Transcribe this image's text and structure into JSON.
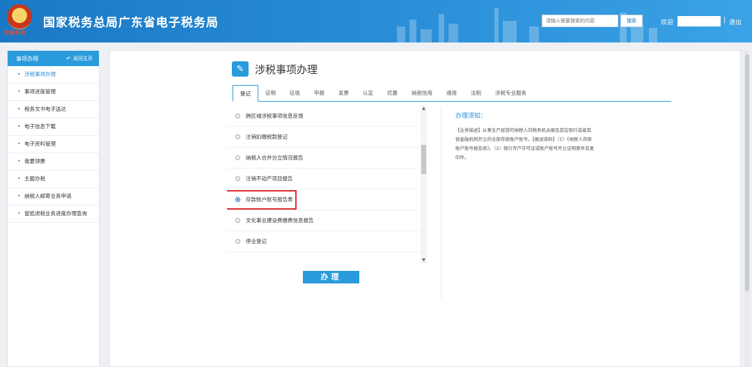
{
  "header": {
    "site_title": "国家税务总局广东省电子税务局",
    "emblem_text": "中国税务",
    "search_placeholder": "请输入需要搜索的内容",
    "search_button": "搜索",
    "welcome": "欢迎",
    "separator": "|",
    "logout": "退出"
  },
  "sidebar": {
    "title": "事项办理",
    "back_label": "返回主页",
    "items": [
      {
        "label": "涉税事项办理",
        "active": true
      },
      {
        "label": "事项进度管理"
      },
      {
        "label": "税务文书电子送达"
      },
      {
        "label": "电子信息下载"
      },
      {
        "label": "电子资料管理"
      },
      {
        "label": "我要领票"
      },
      {
        "label": "主题办税"
      },
      {
        "label": "纳税人邮寄业务申请"
      },
      {
        "label": "留抵退税业务进度办理查询"
      }
    ]
  },
  "main": {
    "title": "涉税事项办理",
    "tabs": [
      "登记",
      "证明",
      "征收",
      "申报",
      "发票",
      "认定",
      "优惠",
      "纳税信用",
      "通用",
      "法制",
      "涉税专业服务"
    ],
    "active_tab": 0,
    "list": [
      "跨区域涉税事项信息反馈",
      "注销扣缴税款登记",
      "纳税人合并分立情况报告",
      "注销不动产项目报告",
      "存款账户账号报告表",
      "文化事业建设费缴费信息报告",
      "停业登记"
    ],
    "selected_index": 4,
    "action_button": "办理",
    "notice": {
      "title": "办理须知：",
      "text": "【业务描述】从事生产经营的纳税人向税务机关报告其在银行或者其他金融机构开立的全部存款账户账号。【报送资料】（1）《纳税人存款账户账号报告表》。（2）银行开户许可证或账户账号开立证明原件及复印件。"
    }
  },
  "colors": {
    "header": "#1b78c4",
    "accent": "#2a9bdc",
    "highlight": "#e02b2b"
  }
}
